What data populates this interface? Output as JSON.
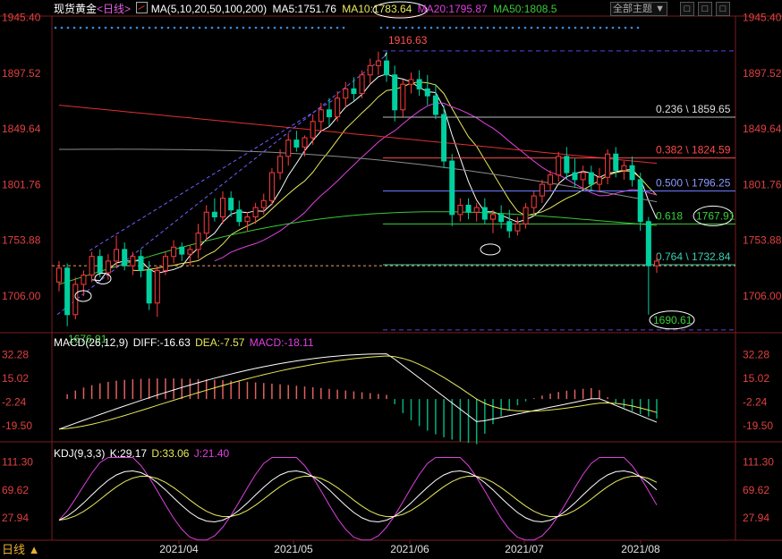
{
  "header": {
    "instrument": "现货黄金",
    "period": "日线",
    "indicator_label": "MA(5,10,20,50,100,200)",
    "ma5": "MA5:1751.76",
    "ma10": "MA10:1783.64",
    "ma20": "MA20:1795.87",
    "ma50": "MA50:1808.5",
    "theme_button": "全部主题",
    "win_buttons": [
      "□",
      "□",
      "□"
    ]
  },
  "macd": {
    "label": "MACD(26,12,9)",
    "diff": "DIFF:-16.63",
    "dea": "DEA:-7.57",
    "macd": "MACD:-18.11"
  },
  "kdj": {
    "label": "KDJ(9,3,3)",
    "k": "K:29.17",
    "d": "D:33.06",
    "j": "J:21.40"
  },
  "footer": {
    "period_button": "日线 ▲"
  },
  "colors": {
    "up": "#ff3b3b",
    "down": "#00d0a0",
    "ma5": "#ffffff",
    "ma10": "#e8e85a",
    "ma20": "#e040e0",
    "ma50": "#38c838",
    "ma100": "#8c8c8c",
    "ma200": "#e03030",
    "dots": "#3a8ce0",
    "macd_diff": "#ffffff",
    "macd_dea": "#e8e85a",
    "macd_pos": "#e06060",
    "macd_neg": "#00b07a",
    "ref_line": "#f0a060"
  },
  "chart_data": [
    {
      "type": "candlestick",
      "title": "现货黄金 日线",
      "ylim": [
        1676,
        1945
      ],
      "y_ticks": [
        1945.4,
        1897.52,
        1849.64,
        1801.76,
        1753.88,
        1706.0
      ],
      "x_ticks": [
        "2021/04",
        "2021/05",
        "2021/06",
        "2021/07",
        "2021/08"
      ],
      "annotations": {
        "high": "1916.63",
        "low": "1676.91",
        "recent_low": "1690.61"
      },
      "fibonacci": [
        {
          "ratio": "0.236",
          "price": "1859.65",
          "label": "0.236 \\ 1859.65"
        },
        {
          "ratio": "0.382",
          "price": "1824.59",
          "label": "0.382 \\ 1824.59"
        },
        {
          "ratio": "0.500",
          "price": "1796.25",
          "label": "0.500 \\ 1796.25"
        },
        {
          "ratio": "0.618",
          "price": "1767.91",
          "label": "0.618"
        },
        {
          "ratio": "0.764",
          "price": "1732.84",
          "label": "0.764 \\ 1732.84"
        }
      ],
      "fib_618_value": "1767.91",
      "current_price": 1732,
      "series": [
        {
          "name": "MA5",
          "values": [
            1751.76
          ]
        },
        {
          "name": "MA10",
          "values": [
            1783.64
          ]
        },
        {
          "name": "MA20",
          "values": [
            1795.87
          ]
        },
        {
          "name": "MA50",
          "values": [
            1808.5
          ]
        }
      ],
      "candles": [
        [
          1718,
          1736,
          1710,
          1730
        ],
        [
          1730,
          1734,
          1680,
          1690
        ],
        [
          1690,
          1722,
          1686,
          1716
        ],
        [
          1716,
          1728,
          1706,
          1724
        ],
        [
          1724,
          1744,
          1718,
          1740
        ],
        [
          1740,
          1746,
          1722,
          1726
        ],
        [
          1726,
          1742,
          1720,
          1736
        ],
        [
          1736,
          1758,
          1730,
          1746
        ],
        [
          1746,
          1752,
          1728,
          1732
        ],
        [
          1732,
          1744,
          1724,
          1740
        ],
        [
          1740,
          1746,
          1722,
          1728
        ],
        [
          1728,
          1736,
          1694,
          1700
        ],
        [
          1700,
          1732,
          1688,
          1728
        ],
        [
          1728,
          1744,
          1724,
          1740
        ],
        [
          1740,
          1754,
          1734,
          1748
        ],
        [
          1748,
          1752,
          1736,
          1742
        ],
        [
          1742,
          1750,
          1732,
          1746
        ],
        [
          1746,
          1768,
          1738,
          1760
        ],
        [
          1760,
          1784,
          1754,
          1778
        ],
        [
          1778,
          1790,
          1770,
          1774
        ],
        [
          1774,
          1796,
          1768,
          1790
        ],
        [
          1790,
          1796,
          1774,
          1780
        ],
        [
          1780,
          1788,
          1766,
          1770
        ],
        [
          1770,
          1778,
          1762,
          1774
        ],
        [
          1774,
          1786,
          1768,
          1782
        ],
        [
          1782,
          1794,
          1776,
          1788
        ],
        [
          1788,
          1816,
          1784,
          1812
        ],
        [
          1812,
          1832,
          1806,
          1826
        ],
        [
          1826,
          1846,
          1818,
          1840
        ],
        [
          1840,
          1848,
          1830,
          1834
        ],
        [
          1834,
          1844,
          1826,
          1842
        ],
        [
          1842,
          1862,
          1836,
          1856
        ],
        [
          1856,
          1872,
          1848,
          1866
        ],
        [
          1866,
          1876,
          1852,
          1860
        ],
        [
          1860,
          1882,
          1856,
          1876
        ],
        [
          1876,
          1890,
          1868,
          1884
        ],
        [
          1884,
          1894,
          1874,
          1880
        ],
        [
          1880,
          1900,
          1876,
          1896
        ],
        [
          1896,
          1910,
          1888,
          1904
        ],
        [
          1904,
          1916,
          1896,
          1908
        ],
        [
          1908,
          1916,
          1890,
          1896
        ],
        [
          1896,
          1904,
          1856,
          1866
        ],
        [
          1866,
          1892,
          1860,
          1888
        ],
        [
          1888,
          1898,
          1880,
          1892
        ],
        [
          1892,
          1900,
          1878,
          1884
        ],
        [
          1884,
          1896,
          1870,
          1878
        ],
        [
          1878,
          1888,
          1858,
          1862
        ],
        [
          1862,
          1870,
          1816,
          1822
        ],
        [
          1822,
          1828,
          1766,
          1776
        ],
        [
          1776,
          1790,
          1770,
          1784
        ],
        [
          1784,
          1790,
          1772,
          1778
        ],
        [
          1778,
          1786,
          1770,
          1782
        ],
        [
          1782,
          1790,
          1768,
          1772
        ],
        [
          1772,
          1780,
          1760,
          1776
        ],
        [
          1776,
          1784,
          1764,
          1770
        ],
        [
          1770,
          1780,
          1756,
          1762
        ],
        [
          1762,
          1774,
          1758,
          1768
        ],
        [
          1768,
          1786,
          1764,
          1782
        ],
        [
          1782,
          1796,
          1776,
          1792
        ],
        [
          1792,
          1806,
          1786,
          1802
        ],
        [
          1802,
          1814,
          1796,
          1810
        ],
        [
          1810,
          1830,
          1804,
          1826
        ],
        [
          1826,
          1834,
          1806,
          1812
        ],
        [
          1812,
          1824,
          1800,
          1806
        ],
        [
          1806,
          1818,
          1798,
          1812
        ],
        [
          1812,
          1818,
          1796,
          1802
        ],
        [
          1802,
          1816,
          1796,
          1808
        ],
        [
          1808,
          1832,
          1802,
          1828
        ],
        [
          1828,
          1834,
          1808,
          1814
        ],
        [
          1814,
          1822,
          1806,
          1818
        ],
        [
          1818,
          1826,
          1800,
          1806
        ],
        [
          1806,
          1812,
          1762,
          1770
        ],
        [
          1770,
          1774,
          1690,
          1732
        ],
        [
          1732,
          1742,
          1726,
          1736
        ]
      ]
    },
    {
      "type": "line",
      "title": "MACD(26,12,9)",
      "y_ticks": [
        32.28,
        15.02,
        -2.24,
        -19.5
      ],
      "series": [
        {
          "name": "DIFF",
          "values": [
            -16.63
          ]
        },
        {
          "name": "DEA",
          "values": [
            -7.57
          ]
        },
        {
          "name": "MACD",
          "values": [
            -18.11
          ]
        }
      ]
    },
    {
      "type": "line",
      "title": "KDJ(9,3,3)",
      "y_ticks": [
        111.3,
        69.62,
        27.94
      ],
      "series": [
        {
          "name": "K",
          "values": [
            29.17
          ]
        },
        {
          "name": "D",
          "values": [
            33.06
          ]
        },
        {
          "name": "J",
          "values": [
            21.4
          ]
        }
      ]
    }
  ]
}
